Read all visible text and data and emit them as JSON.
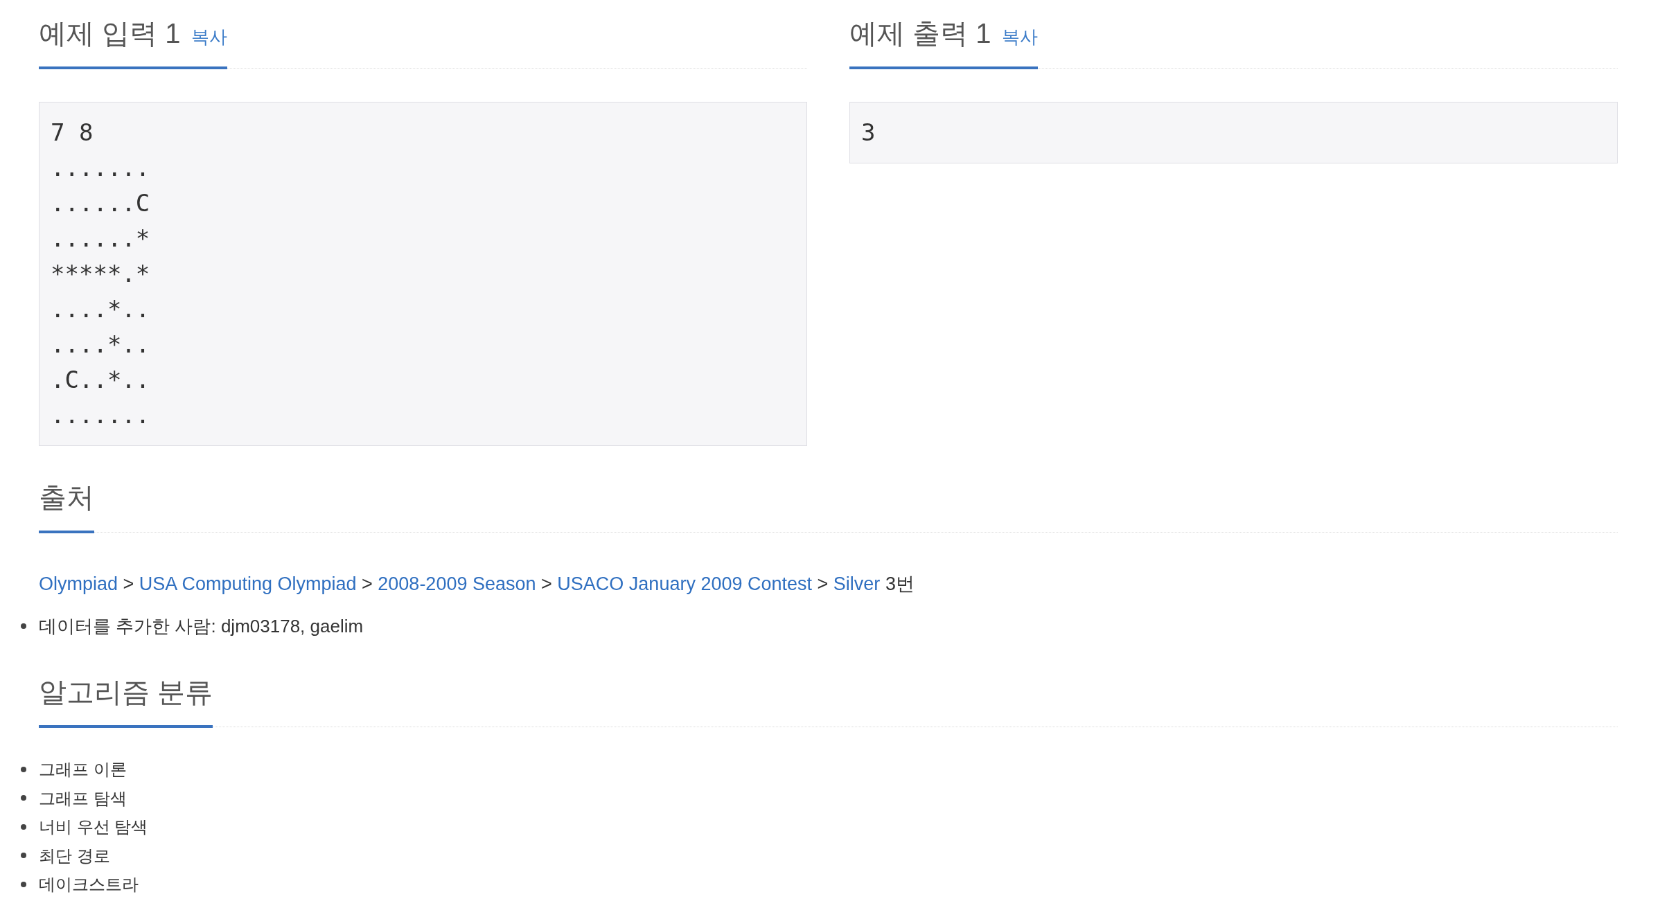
{
  "samples": [
    {
      "title": "예제 입력 1",
      "copy_link": "복사",
      "content": "7 8\n.......\n......C\n......*\n*****.*\n....*..\n....*..\n.C..*..\n......."
    },
    {
      "title": "예제 출력 1",
      "copy_link": "복사",
      "content": "3"
    }
  ],
  "source": {
    "title": "출처",
    "breadcrumb": [
      {
        "kind": "link",
        "text": "Olympiad"
      },
      {
        "kind": "text",
        "text": ">"
      },
      {
        "kind": "link",
        "text": "USA Computing Olympiad"
      },
      {
        "kind": "text",
        "text": ">"
      },
      {
        "kind": "link",
        "text": "2008-2009 Season"
      },
      {
        "kind": "text",
        "text": ">"
      },
      {
        "kind": "link",
        "text": "USACO January 2009 Contest"
      },
      {
        "kind": "text",
        "text": ">"
      },
      {
        "kind": "link",
        "text": "Silver"
      },
      {
        "kind": "text",
        "text": "3번"
      }
    ],
    "notes": [
      "데이터를 추가한 사람: djm03178, gaelim"
    ]
  },
  "algorithm": {
    "title": "알고리즘 분류",
    "tags": [
      "그래프 이론",
      "그래프 탐색",
      "너비 우선 탐색",
      "최단 경로",
      "데이크스트라"
    ]
  }
}
